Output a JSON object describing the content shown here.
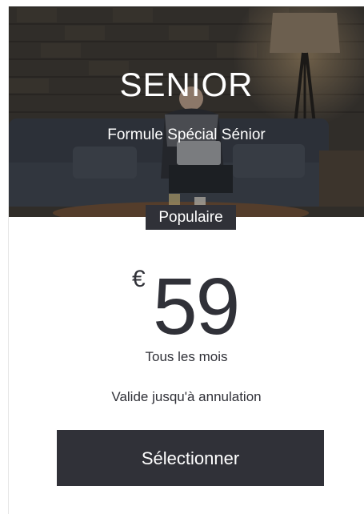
{
  "plan": {
    "title": "SENIOR",
    "subtitle": "Formule Spécial Sénior",
    "badge": "Populaire",
    "currency": "€",
    "price": "59",
    "period": "Tous les mois",
    "validity": "Valide jusqu'à annulation",
    "select_label": "Sélectionner"
  },
  "colors": {
    "dark": "#303138",
    "text_light": "#ffffff"
  }
}
